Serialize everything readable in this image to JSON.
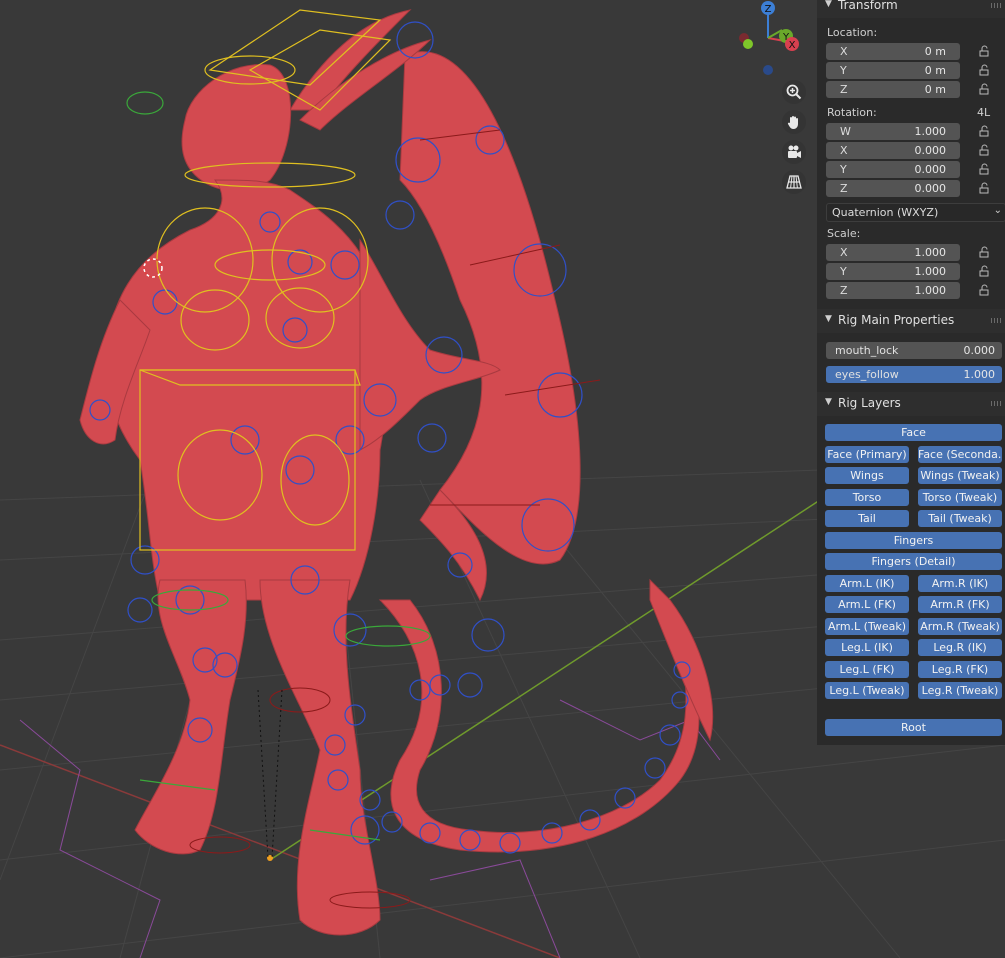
{
  "colors": {
    "viewport_bg": "#393939",
    "grid_line": "#444444",
    "axis_x": "#8a3a3a",
    "axis_y": "#6f9a2c",
    "model": "#d34a50",
    "bone_blue": "#3050c8",
    "bone_yellow": "#e0c020",
    "sidebar_bg": "#2a2a2a",
    "field_bg": "#545454",
    "button_blue": "#4772b3"
  },
  "gizmo": {
    "axis_z": "Z",
    "axis_y": "Y",
    "axis_x": "X",
    "buttons": [
      "zoom-icon",
      "hand-pan-icon",
      "camera-icon",
      "grid-perspective-icon"
    ]
  },
  "sidebar": {
    "transform": {
      "title": "Transform",
      "location_label": "Location:",
      "location": [
        {
          "axis": "X",
          "value": "0 m"
        },
        {
          "axis": "Y",
          "value": "0 m"
        },
        {
          "axis": "Z",
          "value": "0 m"
        }
      ],
      "rotation_label": "Rotation:",
      "rotation_mode_badge": "4L",
      "rotation": [
        {
          "axis": "W",
          "value": "1.000"
        },
        {
          "axis": "X",
          "value": "0.000"
        },
        {
          "axis": "Y",
          "value": "0.000"
        },
        {
          "axis": "Z",
          "value": "0.000"
        }
      ],
      "rotation_mode": "Quaternion (WXYZ)",
      "scale_label": "Scale:",
      "scale": [
        {
          "axis": "X",
          "value": "1.000"
        },
        {
          "axis": "Y",
          "value": "1.000"
        },
        {
          "axis": "Z",
          "value": "1.000"
        }
      ]
    },
    "rig_main": {
      "title": "Rig Main Properties",
      "props": [
        {
          "name": "mouth_lock",
          "value": "0.000"
        },
        {
          "name": "eyes_follow",
          "value": "1.000"
        }
      ]
    },
    "rig_layers": {
      "title": "Rig Layers",
      "buttons": [
        "Face",
        "Face (Primary)",
        "Face (Seconda...",
        "Wings",
        "Wings (Tweak)",
        "Torso",
        "Torso (Tweak)",
        "Tail",
        "Tail (Tweak)",
        "Fingers",
        "Fingers (Detail)",
        "Arm.L (IK)",
        "Arm.R (IK)",
        "Arm.L (FK)",
        "Arm.R (FK)",
        "Arm.L (Tweak)",
        "Arm.R (Tweak)",
        "Leg.L (IK)",
        "Leg.R (IK)",
        "Leg.L (FK)",
        "Leg.R (FK)",
        "Leg.L (Tweak)",
        "Leg.R (Tweak)",
        "Root"
      ]
    }
  }
}
